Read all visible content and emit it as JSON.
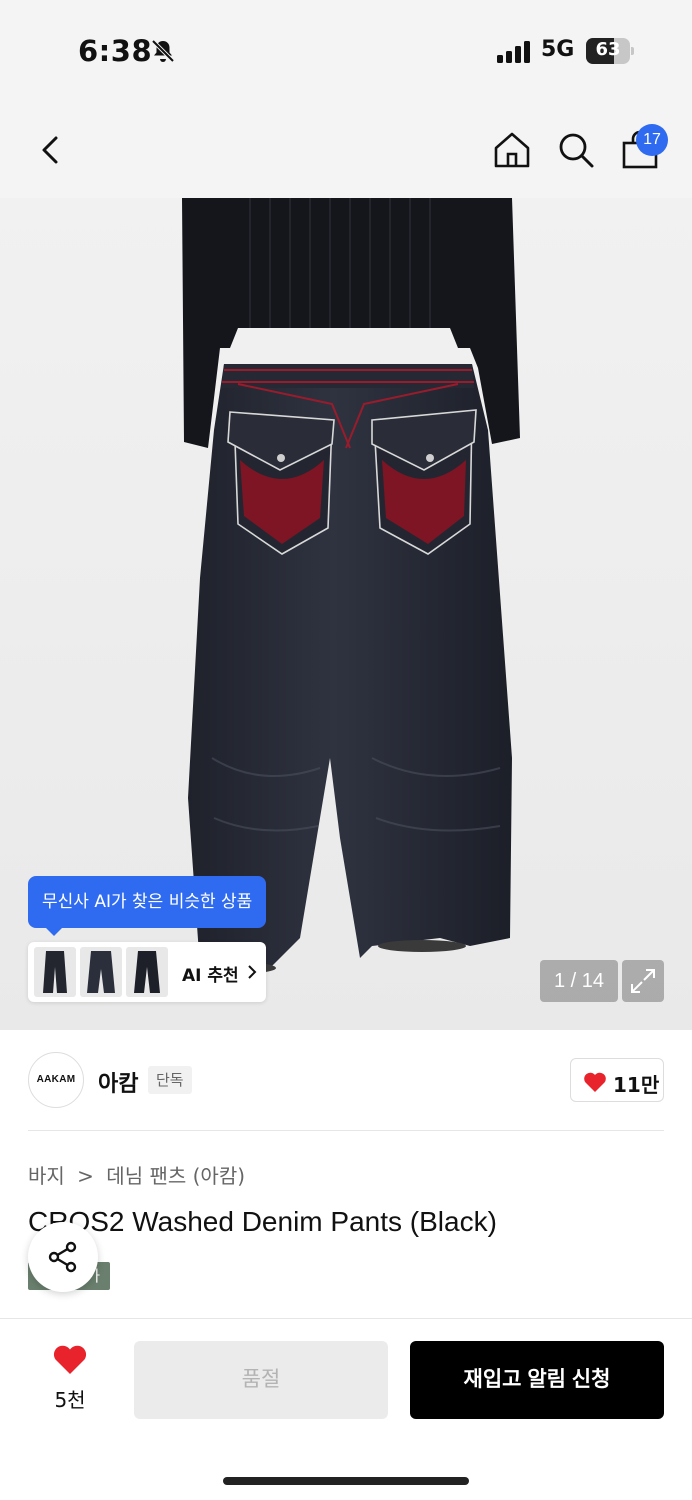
{
  "status_bar": {
    "time": "6:38",
    "network": "5G",
    "battery": "63",
    "battery_level": 63
  },
  "nav": {
    "cart_count": "17"
  },
  "gallery": {
    "ai_tooltip": "무신사 AI가 찾은 비슷한 상품",
    "ai_recommend_label": "AI 추천",
    "counter": "1 / 14"
  },
  "brand": {
    "logo_text": "AAKAM",
    "name": "아캄",
    "tag": "단독",
    "likes": "11만"
  },
  "product": {
    "breadcrumb": [
      "바지",
      "데님 팬츠 (아캄)"
    ],
    "title": "CROS2 Washed Denim Pants (Black)",
    "badge": "특가"
  },
  "bottom_bar": {
    "wish_count": "5천",
    "sold_out_label": "품절",
    "restock_label": "재입고 알림 신청"
  },
  "colors": {
    "accent_blue": "#2f6bf0",
    "heart_red": "#e8232b",
    "denim": "#2a2d38",
    "stitch_red": "#9a1c2c"
  }
}
